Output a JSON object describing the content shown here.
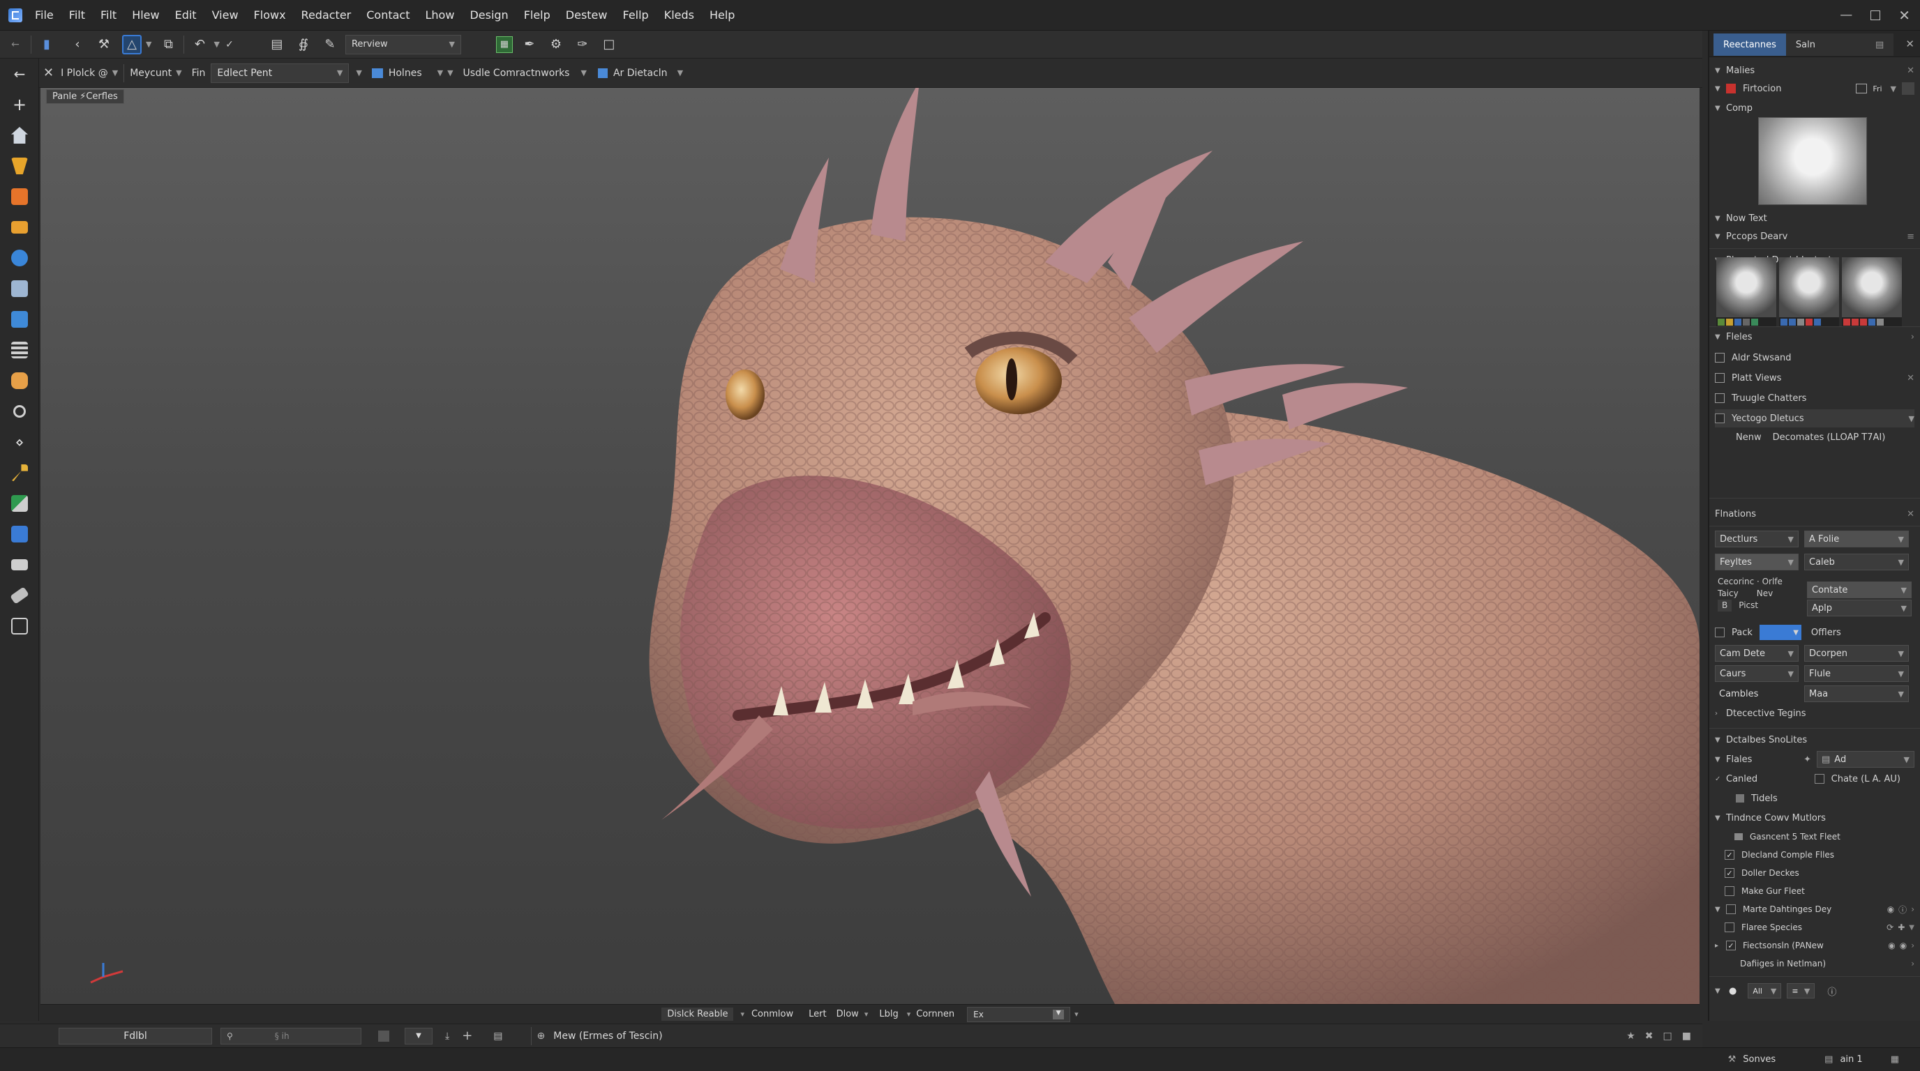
{
  "menu": {
    "items": [
      "File",
      "Filt",
      "Filt",
      "Hlew",
      "Edit",
      "View",
      "Flowx",
      "Redacter",
      "Contact",
      "Lhow",
      "Design",
      "Flelp",
      "Destew",
      "Fellp",
      "Kleds",
      "Help"
    ]
  },
  "toolbar": {
    "review_field": "Rerview"
  },
  "toolbar2": {
    "item1": "I Plolck @",
    "item2": "Meycunt",
    "item3": "Fin",
    "field": "Edlect Pent",
    "item4": "Holnes",
    "item5": "Usdle Comractnworks",
    "item6": "Ar Dietacln"
  },
  "viewport": {
    "chip": "Panle ⚡Cerfles"
  },
  "right_panel": {
    "tabs": [
      "Reectannes",
      "Saln"
    ],
    "section_malies": "Malies",
    "layer_name": "Firtocion",
    "layer_mode": "Fri",
    "comp_label": "Comp",
    "now_text": "Now Text",
    "precops": "Pccops Dearv",
    "planated": "Plamated Dact I Jestest",
    "files_header": "Fleles",
    "list1": [
      "Aldr Stwsand",
      "Platt Views",
      "Truugle Chatters",
      "Yectogo Dletucs"
    ],
    "new_label": "Nenw",
    "new_value": "Decomates (LLOAP T7AI)",
    "finations": "Flnations",
    "props": [
      {
        "left": "Dectlurs",
        "right": "A Folie"
      },
      {
        "left": "Feyltes",
        "right": "Caleb"
      }
    ],
    "cocoric_a": "Cecorinc · Orlfe",
    "cocoric_b": "Taicy",
    "cocoric_c": "Nev",
    "contate": "Contate",
    "b_label": "B",
    "picst": "Picst",
    "aplp": "Aplp",
    "pack": "Pack",
    "offlers": "Offlers",
    "props2": [
      {
        "left": "Cam Dete",
        "right": "Dcorpen"
      },
      {
        "left": "Caurs",
        "right": "Flule"
      },
      {
        "left": "Cambles",
        "right": "Maa"
      }
    ],
    "directive": "Dtecective Tegins",
    "dctalbes": "Dctalbes SnoLites",
    "flales": "Flales",
    "ad": "Ad",
    "canled": "Canled",
    "chate": "Chate (L A. AU)",
    "tidels": "Tidels",
    "tindnce": "Tindnce Cowv Mutlors",
    "sub_items": [
      {
        "label": "Gasncent 5 Text Fleet",
        "checked": false
      },
      {
        "label": "Dlecland Comple Flles",
        "checked": true
      },
      {
        "label": "Doller Deckes",
        "checked": true
      },
      {
        "label": "Make Gur Fleet",
        "checked": false
      },
      {
        "label": "Marte Dahtinges Dey",
        "checked": false
      },
      {
        "label": "Flaree Species",
        "checked": false
      },
      {
        "label": "Fiectsonsln (PANew",
        "checked": true
      }
    ],
    "dafiges": "Dafiiges in Netlman)",
    "bottom_btns": [
      "All"
    ]
  },
  "view_status": {
    "items": [
      "Dislck Reable",
      "Conmlow",
      "Lert",
      "Dlow",
      "Lblg",
      "Cornnen"
    ],
    "field": "Ex"
  },
  "bottom_bar": {
    "left_field": "Fdlbl",
    "search_placeholder": "§ ih",
    "message": "Mew (Ermes of Tescin)"
  },
  "status_bar": {
    "right1": "Sonves",
    "right2": "ain 1"
  },
  "colors": {
    "accent": "#3a7bd5",
    "panel": "#2d2d2d",
    "creature_skin": "#b98a78"
  }
}
